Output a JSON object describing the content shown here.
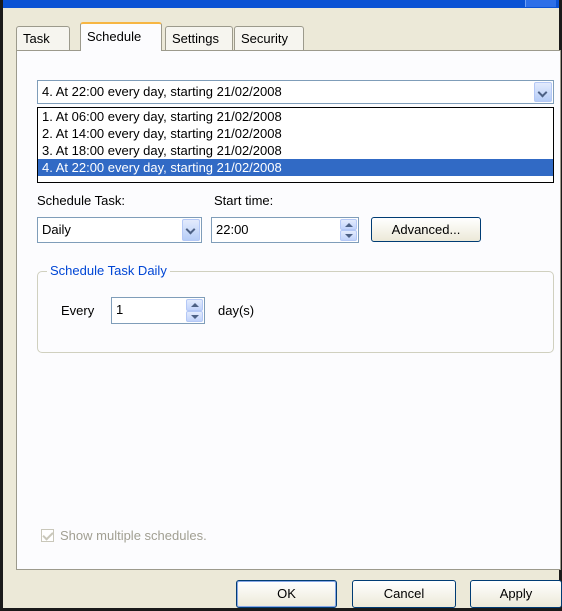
{
  "tabs": [
    {
      "label": "Task",
      "active": false
    },
    {
      "label": "Schedule",
      "active": true
    },
    {
      "label": "Settings",
      "active": false
    },
    {
      "label": "Security",
      "active": false
    }
  ],
  "schedule_combo": {
    "value": "4. At 22:00 every day, starting 21/02/2008"
  },
  "schedule_list": [
    {
      "label": "1. At 06:00 every day, starting 21/02/2008",
      "selected": false
    },
    {
      "label": "2. At 14:00 every day, starting 21/02/2008",
      "selected": false
    },
    {
      "label": "3. At 18:00 every day, starting 21/02/2008",
      "selected": false
    },
    {
      "label": "4. At 22:00 every day, starting 21/02/2008",
      "selected": true
    }
  ],
  "schedule_task": {
    "label": "Schedule Task:",
    "value": "Daily"
  },
  "start_time": {
    "label": "Start time:",
    "value": "22:00"
  },
  "advanced_button": "Advanced...",
  "daily_group": {
    "title": "Schedule Task Daily",
    "every_label": "Every",
    "every_value": "1",
    "unit_label": "day(s)"
  },
  "show_multiple": {
    "label": "Show multiple schedules.",
    "checked": true,
    "enabled": false
  },
  "buttons": {
    "ok": "OK",
    "cancel": "Cancel",
    "apply": "Apply"
  },
  "colors": {
    "titlebar": "#0a52d4",
    "selection": "#316ac5",
    "group_title": "#0046d5",
    "active_tab_accent": "#f7b643"
  }
}
